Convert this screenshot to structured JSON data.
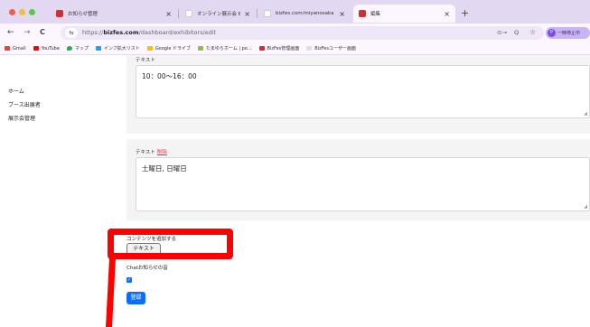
{
  "browser": {
    "tabs": [
      {
        "title": "お知らせ管理",
        "icon": "bizfes-favicon",
        "active": false
      },
      {
        "title": "オンライン展示会 BizFes（ビズ",
        "icon": "blank-favicon",
        "active": false
      },
      {
        "title": "bizfes.com/miyanosaka",
        "icon": "blank-favicon",
        "active": false
      },
      {
        "title": "編集",
        "icon": "bizfes-favicon",
        "active": true
      }
    ],
    "close_glyph": "×",
    "new_tab_glyph": "+",
    "back_glyph": "←",
    "forward_glyph": "→",
    "reload_glyph": "C",
    "site_info_glyph": "⇆",
    "url_prefix": "https://",
    "url_domain": "bizfes.com",
    "url_path": "/dashboard/exhibitors/edit",
    "key_glyph": "⊙⊸",
    "zoom_glyph": "Q",
    "star_glyph": "☆",
    "profile_initial": "P",
    "profile_label": "一時停止中"
  },
  "bookmarks": [
    {
      "label": "Gmail",
      "color": "#ea4335"
    },
    {
      "label": "YouTube",
      "color": "#ff0000"
    },
    {
      "label": "マップ",
      "color": "#34a853"
    },
    {
      "label": "インフ拡大リスト",
      "color": "#1da1f2"
    },
    {
      "label": "Google ドライブ",
      "color": "#fbbc04"
    },
    {
      "label": "たまゆらホーム | po...",
      "color": "#8bc34a"
    },
    {
      "label": "BizFes管理画面",
      "color": "#d32f2f"
    },
    {
      "label": "BizFesユーザー画面",
      "color": "#e0e0e0"
    }
  ],
  "sidebar": {
    "items": [
      {
        "label": "ホーム"
      },
      {
        "label": "ブース出展者"
      },
      {
        "label": "展示会管理"
      }
    ]
  },
  "main": {
    "fields": [
      {
        "label": "テキスト",
        "delete_label": "",
        "value": "10：00〜16：00"
      },
      {
        "label": "テキスト",
        "delete_label": "削除",
        "value": "土曜日, 日曜日"
      }
    ],
    "resize_glyph": "◢",
    "add_content_label": "コンテンツを追加する",
    "add_text_button": "テキスト",
    "chat_notify_label": "Chatお知らせの音",
    "chat_notify_checked": true,
    "check_glyph": "✓",
    "submit_button": "登録"
  },
  "colors": {
    "accent": "#0d6efd",
    "delete_link": "#dc3545",
    "annotation": "#ff0000",
    "tab_strip": "#e3d8f1"
  }
}
